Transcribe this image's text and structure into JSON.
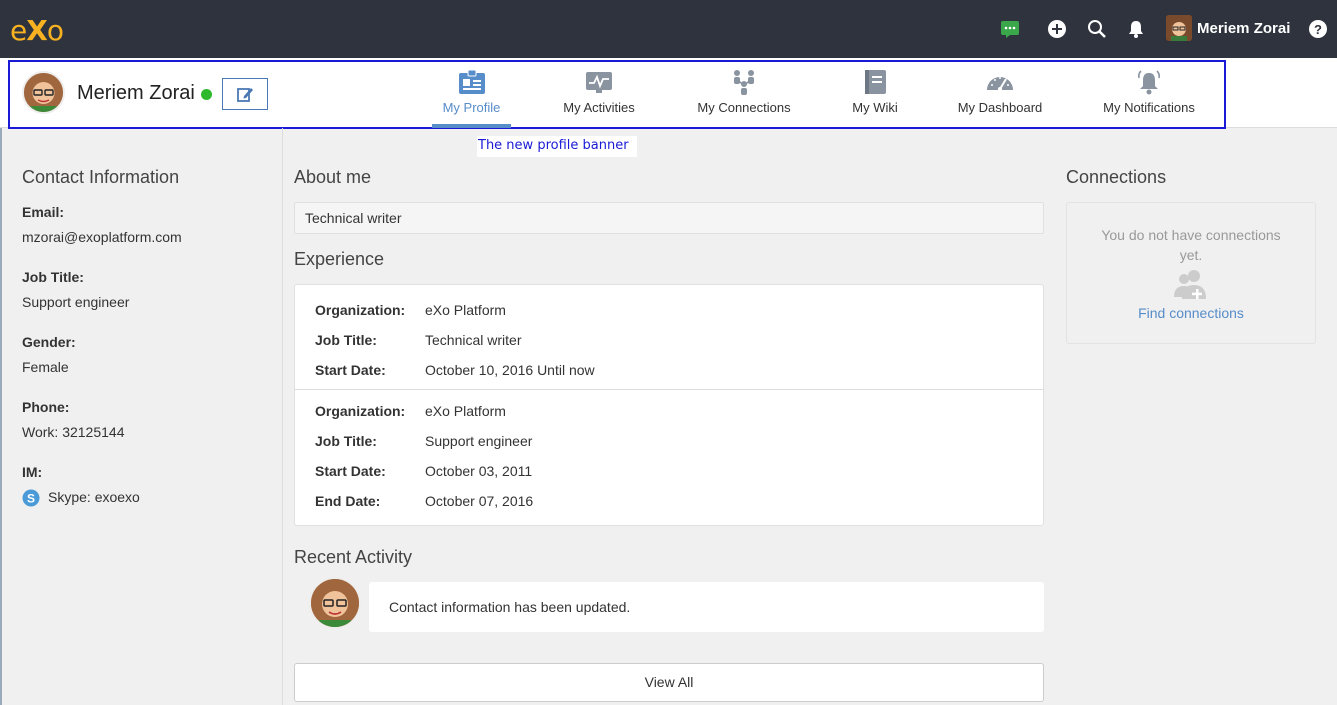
{
  "topbar": {
    "logo_e": "e",
    "logo_x": "X",
    "logo_o": "o",
    "user_name": "Meriem Zorai",
    "icons": [
      "chat-icon",
      "plus-circle-icon",
      "search-icon",
      "bell-icon",
      "help-icon"
    ]
  },
  "banner": {
    "name": "Meriem Zorai",
    "status": "online",
    "nav": [
      {
        "label": "My Profile",
        "icon": "profile-icon",
        "active": true
      },
      {
        "label": "My Activities",
        "icon": "activity-icon"
      },
      {
        "label": "My Connections",
        "icon": "connections-icon"
      },
      {
        "label": "My Wiki",
        "icon": "wiki-icon"
      },
      {
        "label": "My Dashboard",
        "icon": "dashboard-icon"
      },
      {
        "label": "My Notifications",
        "icon": "notifications-icon"
      }
    ]
  },
  "tooltip": "The new profile banner",
  "contact": {
    "title": "Contact Information",
    "email_label": "Email:",
    "email": "mzorai@exoplatform.com",
    "job_label": "Job Title:",
    "job": "Support engineer",
    "gender_label": "Gender:",
    "gender": "Female",
    "phone_label": "Phone:",
    "phone": "Work: 32125144",
    "im_label": "IM:",
    "im": "Skype: exoexo"
  },
  "about": {
    "title": "About me",
    "text": "Technical writer"
  },
  "experience": {
    "title": "Experience",
    "entries": [
      {
        "org_label": "Organization:",
        "org": "eXo Platform",
        "job_label": "Job Title:",
        "job": "Technical writer",
        "start_label": "Start Date:",
        "start": "October 10, 2016 Until now"
      },
      {
        "org_label": "Organization:",
        "org": "eXo Platform",
        "job_label": "Job Title:",
        "job": "Support engineer",
        "start_label": "Start Date:",
        "start": "October 03, 2011",
        "end_label": "End Date:",
        "end": "October 07, 2016"
      }
    ]
  },
  "recent": {
    "title": "Recent Activity",
    "item": "Contact information has been updated.",
    "view_all": "View All"
  },
  "connections": {
    "title": "Connections",
    "empty": "You do not have connections yet.",
    "find": "Find connections"
  },
  "colors": {
    "topbar": "#2e333d",
    "accent": "#578dc9",
    "logo": "#f8b121",
    "highlight": "#1a1ad6",
    "online": "#2eb82e"
  }
}
